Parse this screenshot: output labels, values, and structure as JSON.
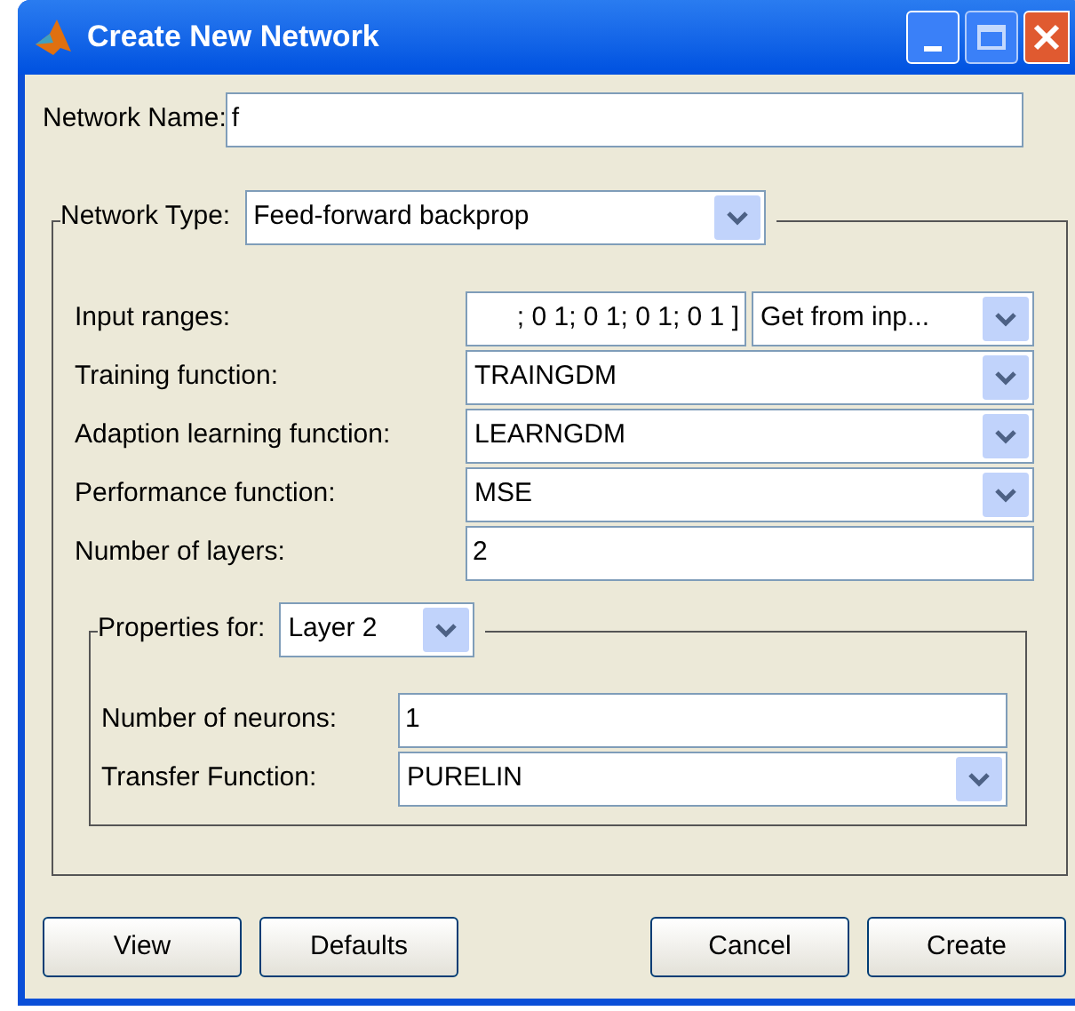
{
  "window": {
    "title": "Create New Network"
  },
  "network_name": {
    "label": "Network Name:",
    "value": "f"
  },
  "network_type": {
    "label": "Network Type:",
    "value": "Feed-forward backprop"
  },
  "fields": [
    {
      "kind": "range",
      "label": "Input ranges:",
      "value": "; 0 1; 0 1; 0 1; 0 1 ]",
      "option": "Get from inp..."
    },
    {
      "kind": "dropdown",
      "label": "Training function:",
      "value": "TRAINGDM"
    },
    {
      "kind": "dropdown",
      "label": "Adaption learning function:",
      "value": "LEARNGDM"
    },
    {
      "kind": "dropdown",
      "label": "Performance function:",
      "value": "MSE"
    },
    {
      "kind": "text",
      "label": "Number of layers:",
      "value": "2"
    }
  ],
  "layer_properties": {
    "label": "Properties for:",
    "value": "Layer 2",
    "fields": [
      {
        "kind": "text",
        "label": "Number of neurons:",
        "value": "1"
      },
      {
        "kind": "dropdown",
        "label": "Transfer Function:",
        "value": "PURELIN"
      }
    ]
  },
  "buttons": [
    "View",
    "Defaults",
    "Cancel",
    "Create"
  ]
}
